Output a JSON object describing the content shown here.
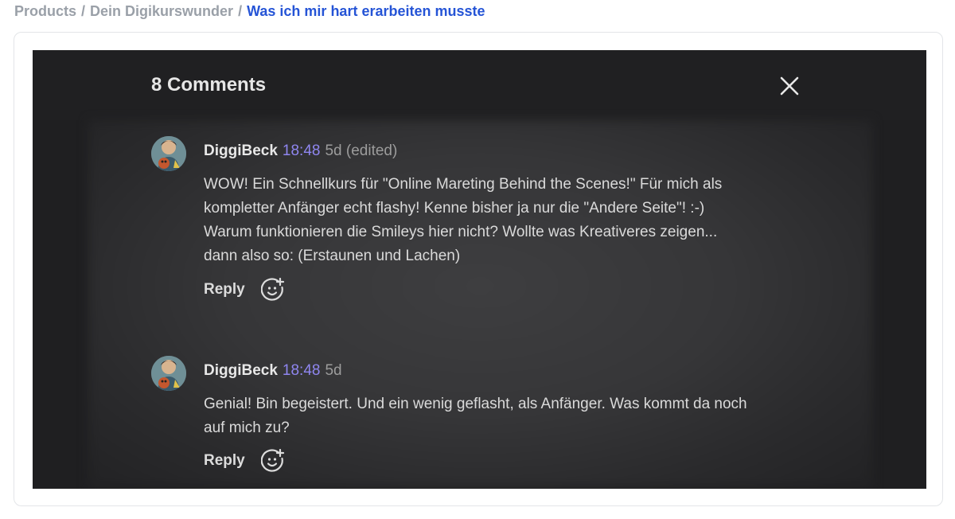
{
  "breadcrumb": {
    "items": [
      "Products",
      "Dein Digikurswunder"
    ],
    "current": "Was ich mir hart erarbeiten musste",
    "separator": "/"
  },
  "comments_panel": {
    "title": "8 Comments",
    "close_icon": "close-icon"
  },
  "comments": [
    {
      "author": "DiggiBeck",
      "time": "18:48",
      "age": "5d (edited)",
      "lines": [
        "WOW! Ein Schnellkurs für \"Online Mareting Behind the Scenes!\" Für mich als",
        "kompletter Anfänger echt flashy! Kenne bisher ja nur die \"Andere Seite\"! :-)",
        "Warum funktionieren die Smileys hier nicht? Wollte was Kreativeres zeigen...",
        "dann also so: (Erstaunen und Lachen)"
      ],
      "reply_label": "Reply",
      "react_icon": "add-reaction-icon"
    },
    {
      "author": "DiggiBeck",
      "time": "18:48",
      "age": "5d",
      "lines": [
        "Genial! Bin begeistert. Und ein wenig geflasht, als Anfänger. Was kommt da noch",
        "auf mich zu?"
      ],
      "reply_label": "Reply",
      "react_icon": "add-reaction-icon"
    }
  ],
  "colors": {
    "breadcrumb_muted": "#9aa0a8",
    "breadcrumb_current": "#2554d6",
    "panel_bg": "#1f1f21",
    "time_accent": "#8f86f0"
  }
}
